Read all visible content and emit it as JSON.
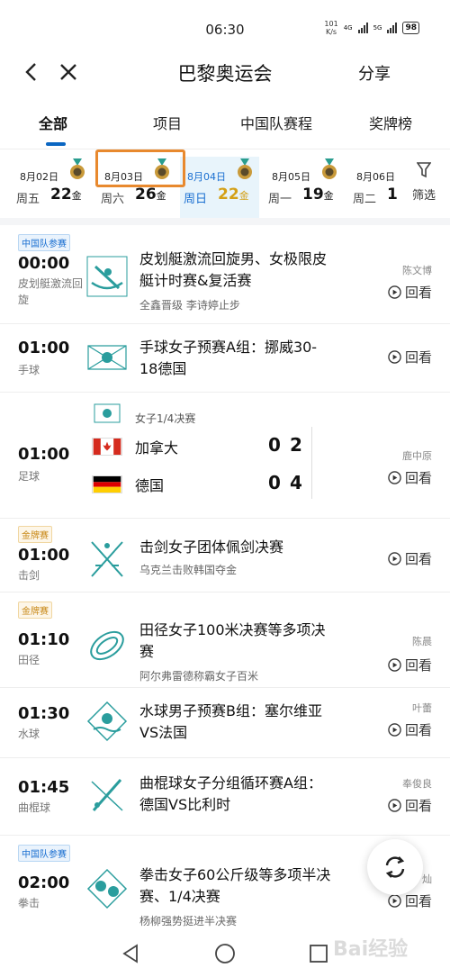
{
  "status_bar": {
    "time": "06:30",
    "net_speed": "101",
    "net_unit": "K/s",
    "net1": "4G",
    "net2": "5G",
    "battery": "98"
  },
  "header": {
    "title": "巴黎奥运会",
    "share": "分享"
  },
  "tabs": [
    {
      "label": "全部"
    },
    {
      "label": "项目"
    },
    {
      "label": "中国队赛程"
    },
    {
      "label": "奖牌榜"
    }
  ],
  "dates": [
    {
      "date": "8月02日",
      "weekday": "周五",
      "golds": "22",
      "unit": "金"
    },
    {
      "date": "8月03日",
      "weekday": "周六",
      "golds": "26",
      "unit": "金"
    },
    {
      "date": "8月04日",
      "weekday": "周日",
      "golds": "22",
      "unit": "金"
    },
    {
      "date": "8月05日",
      "weekday": "周一",
      "golds": "19",
      "unit": "金"
    },
    {
      "date": "8月06日",
      "weekday": "周二",
      "golds": "1",
      "unit": ""
    }
  ],
  "filter_label": "筛选",
  "replay_label": "回看",
  "events": [
    {
      "badge": "中国队参赛",
      "time": "00:00",
      "sport": "皮划艇激流回旋",
      "title": "皮划艇激流回旋男、女极限皮艇计时赛&复活赛",
      "sub": "全鑫晋级 李诗婷止步",
      "commentator": "陈文博"
    },
    {
      "time": "01:00",
      "sport": "手球",
      "title": "手球女子预赛A组：挪威30-18德国"
    },
    {
      "time": "01:00",
      "sport": "足球",
      "stage": "女子1/4决赛",
      "team1": "加拿大",
      "team2": "德国",
      "t1s1": "0",
      "t1s2": "2",
      "t2s1": "0",
      "t2s2": "4",
      "commentator": "鹿中原"
    },
    {
      "badge": "金牌赛",
      "time": "01:00",
      "sport": "击剑",
      "title": "击剑女子团体佩剑决赛",
      "sub": "乌克兰击败韩国夺金"
    },
    {
      "badge": "金牌赛",
      "time": "01:10",
      "sport": "田径",
      "title": "田径女子100米决赛等多项决赛",
      "sub": "阿尔弗雷德称霸女子百米",
      "commentator": "陈晨"
    },
    {
      "time": "01:30",
      "sport": "水球",
      "title": "水球男子预赛B组：塞尔维亚VS法国",
      "commentator": "叶蕾"
    },
    {
      "time": "01:45",
      "sport": "曲棍球",
      "title": "曲棍球女子分组循环赛A组：德国VS比利时",
      "commentator": "奉俊良"
    },
    {
      "badge": "中国队参赛",
      "time": "02:00",
      "sport": "拳击",
      "title": "拳击女子60公斤级等多项半决赛、1/4决赛",
      "sub": "杨柳强势挺进半决赛",
      "commentator": "灿"
    }
  ],
  "watermark": "Bai经验"
}
